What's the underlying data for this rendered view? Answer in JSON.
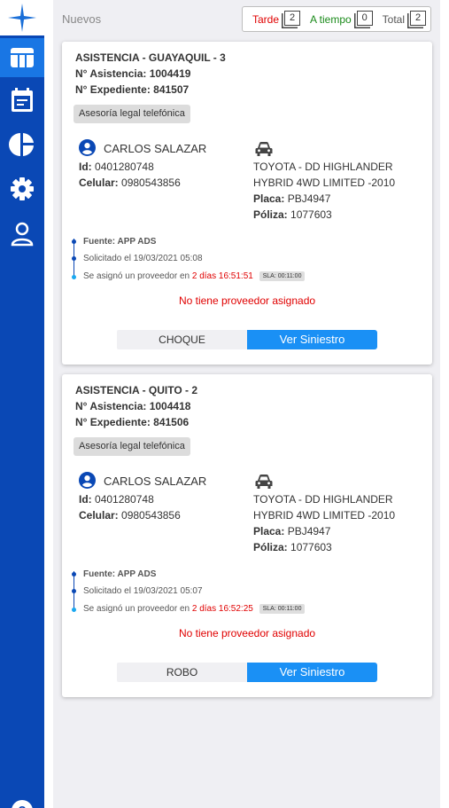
{
  "header": {
    "section_title": "Nuevos",
    "counters": [
      {
        "label": "Tarde",
        "value": "2",
        "color": "#e00000"
      },
      {
        "label": "A tiempo",
        "value": "0",
        "color": "#1a8a1a"
      },
      {
        "label": "Total",
        "value": "2",
        "color": "#555555"
      }
    ]
  },
  "sidebar": {
    "items": [
      {
        "icon": "star-logo-icon"
      },
      {
        "icon": "table-icon",
        "active": true
      },
      {
        "icon": "calendar-icon"
      },
      {
        "icon": "pie-chart-icon"
      },
      {
        "icon": "gear-icon"
      },
      {
        "icon": "user-icon"
      },
      {
        "icon": "help-icon"
      }
    ]
  },
  "cards": [
    {
      "title": "ASISTENCIA - GUAYAQUIL - 3",
      "asistencia": "N° Asistencia: 1004419",
      "expediente": "N° Expediente: 841507",
      "service": "Asesoría legal telefónica",
      "person_name": "CARLOS SALAZAR",
      "id_label": "Id:",
      "id_value": "0401280748",
      "phone_label": "Celular:",
      "phone_value": "0980543856",
      "vehicle_line1": "TOYOTA - DD HIGHLANDER",
      "vehicle_line2": "HYBRID 4WD LIMITED -2010",
      "plate_label": "Placa:",
      "plate_value": "PBJ4947",
      "policy_label": "Póliza:",
      "policy_value": "1077603",
      "source": "Fuente: APP ADS",
      "requested": "Solicitado el 19/03/2021 05:08",
      "assigned_text": "Se asignó un proveedor en",
      "assigned_time": "2 días 16:51:51",
      "sla": "SLA: 00:11:00",
      "no_provider": "No tiene proveedor asignado",
      "type_label": "CHOQUE",
      "view_label": "Ver Siniestro"
    },
    {
      "title": "ASISTENCIA - QUITO - 2",
      "asistencia": "N° Asistencia: 1004418",
      "expediente": "N° Expediente: 841506",
      "service": "Asesoría legal telefónica",
      "person_name": "CARLOS SALAZAR",
      "id_label": "Id:",
      "id_value": "0401280748",
      "phone_label": "Celular:",
      "phone_value": "0980543856",
      "vehicle_line1": "TOYOTA - DD HIGHLANDER",
      "vehicle_line2": "HYBRID 4WD LIMITED -2010",
      "plate_label": "Placa:",
      "plate_value": "PBJ4947",
      "policy_label": "Póliza:",
      "policy_value": "1077603",
      "source": "Fuente: APP ADS",
      "requested": "Solicitado el 19/03/2021 05:07",
      "assigned_text": "Se asignó un proveedor en",
      "assigned_time": "2 días 16:52:25",
      "sla": "SLA: 00:11:00",
      "no_provider": "No tiene proveedor asignado",
      "type_label": "ROBO",
      "view_label": "Ver Siniestro"
    }
  ]
}
